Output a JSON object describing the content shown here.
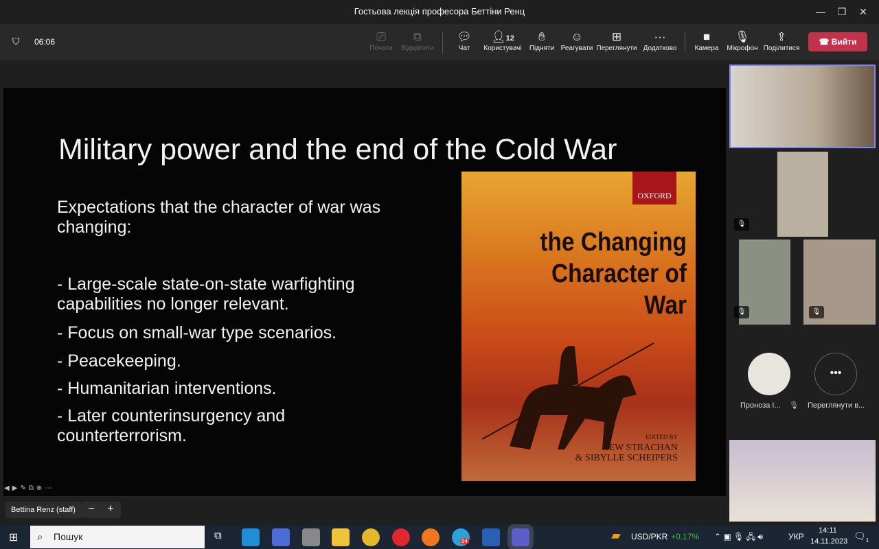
{
  "window": {
    "title": "Гостьова лекція професора Беттіни Ренц"
  },
  "toolbar": {
    "timer": "06:06",
    "buttons": [
      {
        "label": "Почати",
        "icon": "screen-present-icon",
        "disabled": true
      },
      {
        "label": "Відкріпити",
        "icon": "pop-out-icon",
        "disabled": true
      },
      {
        "label": "Чат",
        "icon": "chat-icon"
      },
      {
        "label": "Користувачі",
        "icon": "people-icon",
        "badge": "12"
      },
      {
        "label": "Підняти",
        "icon": "raise-hand-icon"
      },
      {
        "label": "Реагувати",
        "icon": "smiley-icon"
      },
      {
        "label": "Переглянути",
        "icon": "view-icon"
      },
      {
        "label": "Додатково",
        "icon": "more-icon"
      },
      {
        "label": "Камера",
        "icon": "camera-icon"
      },
      {
        "label": "Мікрофон",
        "icon": "mic-off-icon"
      },
      {
        "label": "Поділитися",
        "icon": "share-icon"
      }
    ],
    "leave": "Вийти"
  },
  "slide": {
    "title": "Military power and the end of the Cold War",
    "intro": "Expectations that the character of war was changing:",
    "bullets": [
      "- Large-scale state-on-state warfighting capabilities no longer relevant.",
      "- Focus on small-war type scenarios.",
      "- Peacekeeping.",
      "- Humanitarian interventions.",
      "- Later counterinsurgency and counterterrorism."
    ],
    "book": {
      "publisher": "OXFORD",
      "title_1": "the Changing",
      "title_2": "Character of War",
      "edited_by": "EDITED BY",
      "editor_1": "HEW STRACHAN",
      "editor_2": "& SIBYLLE SCHEIPERS"
    }
  },
  "presenter": {
    "name": "Bettina Renz (staff)",
    "zoom_out": "−",
    "zoom_in": "+"
  },
  "participants": {
    "avatar_name": "Проноза І...",
    "view_more": "Переглянути в..."
  },
  "taskbar": {
    "search": "Пошук",
    "ticker": "USD/PKR",
    "ticker_change": "+0.17%",
    "lang": "УКР",
    "time": "14:11",
    "date": "14.11.2023",
    "notifications": "1",
    "telegram_badge": "94",
    "accent_up": "#3fbf3f"
  }
}
